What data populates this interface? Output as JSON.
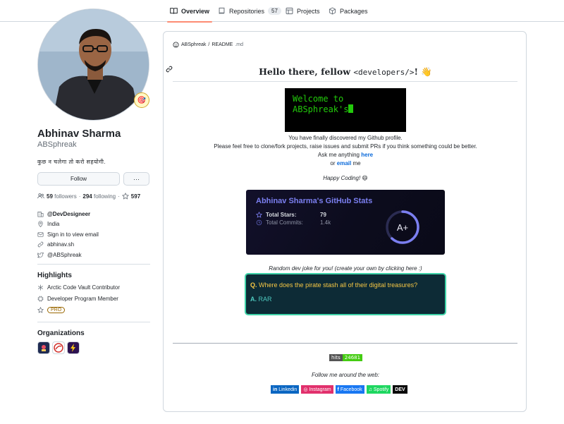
{
  "tabs": [
    {
      "label": "Overview",
      "active": true,
      "icon": "book-icon"
    },
    {
      "label": "Repositories",
      "count": "57",
      "icon": "repo-icon"
    },
    {
      "label": "Projects",
      "icon": "table-icon"
    },
    {
      "label": "Packages",
      "icon": "package-icon"
    }
  ],
  "profile": {
    "name": "Abhinav Sharma",
    "login": "ABSphreak",
    "bio": "कुछ न चलेगा तो करो सहयोगी.",
    "status_emoji": "🎯",
    "follow_label": "Follow",
    "more_label": "···",
    "followers_count": "59",
    "followers_label": "followers",
    "following_count": "294",
    "following_label": "following",
    "stars_count": "597",
    "company": "@DevDesigneer",
    "location": "India",
    "email": "Sign in to view email",
    "website": "abhinav.sh",
    "twitter": "@ABSphreak"
  },
  "highlights": {
    "title": "Highlights",
    "items": [
      "Arctic Code Vault Contributor",
      "Developer Program Member"
    ],
    "pro": "PRO"
  },
  "organizations": {
    "title": "Organizations"
  },
  "readme": {
    "path_user": "ABSphreak",
    "path_sep": "/",
    "path_file": "README",
    "path_ext": ".md",
    "title_prefix": "Hello there, fellow ",
    "title_code": "<developers/>",
    "title_suffix": "!",
    "wave": "👋",
    "terminal_line1": "Welcome to",
    "terminal_line2": "ABSphreak's",
    "line1": "You have finally discovered my Github profile.",
    "line2": "Please feel free to clone/fork projects, raise issues and submit PRs if you think something could be better.",
    "line3_prefix": "Ask me anything ",
    "line3_link": "here",
    "line4_prefix": "or ",
    "line4_link": "email",
    "line4_suffix": " me",
    "happy": "Happy Coding! 😄",
    "stats": {
      "title": "Abhinav Sharma's GitHub Stats",
      "stars_label": "Total Stars:",
      "stars_value": "79",
      "commits_label": "Total Commits:",
      "commits_value": "1.4k",
      "grade": "A+",
      "accent": "#7b7ff0",
      "ring_fraction": 0.62
    },
    "joke_caption": "Random dev joke for you! (create your own by clicking here :)",
    "joke_q_label": "Q.",
    "joke_q": "Where does the pirate stash all of their digital treasures?",
    "joke_a_label": "A.",
    "joke_a": "RAR",
    "hits_label": "hits",
    "hits_value": "24681",
    "follow_caption": "Follow me around the web:",
    "socials": [
      {
        "label": "Linkedin",
        "glyph": "in",
        "color": "#0a66c2"
      },
      {
        "label": "Instagram",
        "glyph": "◎",
        "color": "#e1306c"
      },
      {
        "label": "Facebook",
        "glyph": "f",
        "color": "#1877f2"
      },
      {
        "label": "Spotify",
        "glyph": "♫",
        "color": "#1ed760"
      },
      {
        "label": "DEV",
        "glyph": "DEV",
        "color": "#0a0a0a"
      }
    ]
  }
}
